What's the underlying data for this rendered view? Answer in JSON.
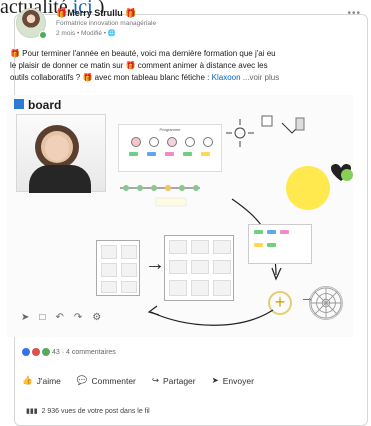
{
  "top": {
    "prefix": "actualité",
    "link": "ici",
    "suffix": ")"
  },
  "post": {
    "author": "🎁Merry Strullu 🎁",
    "title": "Formatrice innovation managériale",
    "meta": "2 mois • Modifié • 🌐",
    "menu_icon": "ellipsis-icon",
    "body_line1": "🎁 Pour terminer l'année en beauté, voici ma dernière formation que j'ai eu",
    "body_line2": "le plaisir de donner ce matin sur 🎁 comment animer à distance avec les",
    "body_line3_start": "outils collaboratifs ? 🎁 avec mon tableau blanc fétiche : ",
    "body_line3_link": "Klaxoon",
    "body_line3_end": " ...voir plus"
  },
  "board": {
    "logo": "board",
    "program_title": "Programme"
  },
  "stats": {
    "reactions": "43 · 4 commentaires"
  },
  "actions": {
    "like": "J'aime",
    "comment": "Commenter",
    "share": "Partager",
    "send": "Envoyer"
  },
  "views": "2 936 vues de votre post dans le fil",
  "icons": {
    "like": "thumb-icon",
    "comment": "comment-icon",
    "share": "share-icon",
    "send": "send-icon",
    "views": "bar-chart-icon"
  }
}
